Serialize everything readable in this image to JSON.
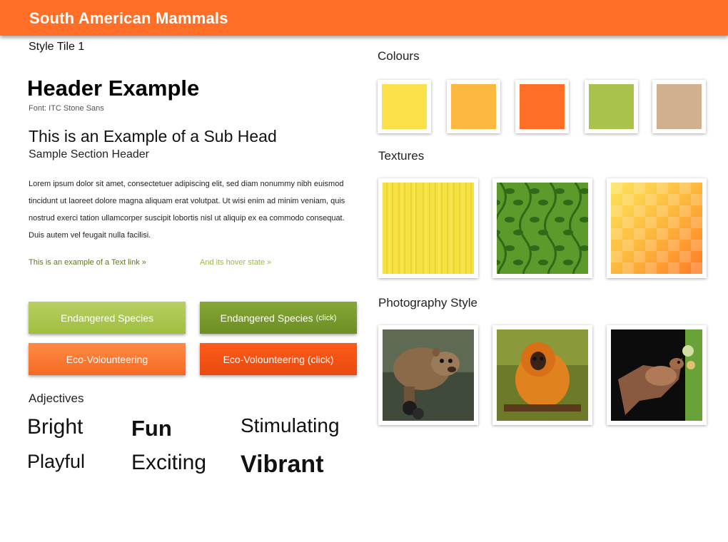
{
  "topbar": {
    "title": "South American Mammals"
  },
  "left": {
    "tile_label": "Style Tile 1",
    "header_example": "Header Example",
    "font_note": "Font: ITC Stone Sans",
    "subhead": "This is an Example of a Sub Head",
    "section_header": "Sample Section Header",
    "lorem": "Lorem ipsum dolor sit amet, consectetuer adipiscing elit, sed diam nonummy nibh euismod tincidunt ut laoreet dolore magna aliquam erat volutpat. Ut wisi enim ad minim veniam, quis nostrud exerci tation ullamcorper suscipit lobortis nisl ut aliquip ex ea commodo consequat. Duis autem vel feugait nulla facilisi.",
    "text_link": "This is an example of a Text link »",
    "hover_link": "And its hover state »",
    "buttons": {
      "endangered": "Endangered Species",
      "endangered_click_main": "Endangered Species",
      "endangered_click_note": "(click)",
      "eco": "Eco-Volounteering",
      "eco_click": "Eco-Volounteering (click)"
    },
    "adjectives_title": "Adjectives",
    "adjectives": [
      "Bright",
      "Fun",
      "Stimulating",
      "Playful",
      "Exciting",
      "Vibrant"
    ]
  },
  "right": {
    "colours_title": "Colours",
    "colours": [
      "#fbe04a",
      "#fdb840",
      "#ff6f28",
      "#a9c24c",
      "#d0b08e"
    ],
    "textures_title": "Textures",
    "textures": [
      "yellow-stripes-texture",
      "green-leaf-vine-texture",
      "yellow-orange-checker-texture"
    ],
    "photo_title": "Photography Style",
    "photos": [
      "olingo-photo",
      "golden-lion-tamarin-photo",
      "nectar-bat-photo"
    ]
  }
}
